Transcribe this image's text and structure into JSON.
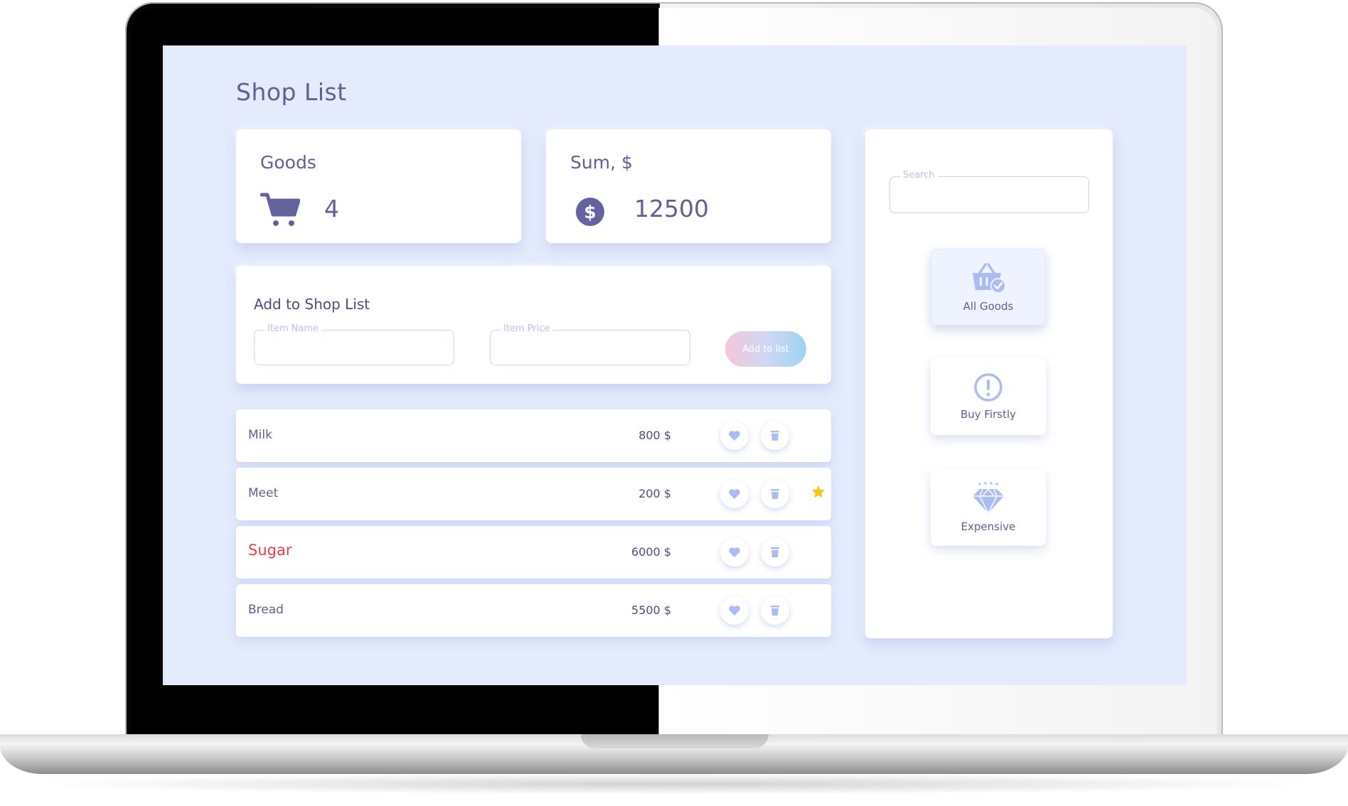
{
  "page": {
    "title": "Shop List"
  },
  "stats": {
    "goods": {
      "label": "Goods",
      "value": "4",
      "icon": "cart-icon"
    },
    "sum": {
      "label": "Sum, $",
      "value": "12500",
      "icon": "dollar-icon"
    }
  },
  "add_form": {
    "title": "Add to Shop List",
    "item_name": {
      "label": "Item Name",
      "value": ""
    },
    "item_price": {
      "label": "Item Price",
      "value": ""
    },
    "button_label": "Add to list"
  },
  "items": [
    {
      "name": "Milk",
      "price": "800 $",
      "highlight": false,
      "starred": false
    },
    {
      "name": "Meet",
      "price": "200 $",
      "highlight": false,
      "starred": true
    },
    {
      "name": "Sugar",
      "price": "6000 $",
      "highlight": true,
      "starred": false
    },
    {
      "name": "Bread",
      "price": "5500 $",
      "highlight": false,
      "starred": false
    }
  ],
  "sidebar": {
    "search": {
      "label": "Search",
      "value": ""
    },
    "filters": [
      {
        "label": "All Goods",
        "icon": "basket-check-icon",
        "active": true
      },
      {
        "label": "Buy Firstly",
        "icon": "exclamation-icon",
        "active": false
      },
      {
        "label": "Expensive",
        "icon": "diamond-icon",
        "active": false
      }
    ]
  },
  "colors": {
    "screen_bg": "#e3ebfd",
    "text_primary": "#5f5e96",
    "accent_light": "#abbcf4",
    "alert": "#e64343",
    "star": "#f5c518"
  }
}
